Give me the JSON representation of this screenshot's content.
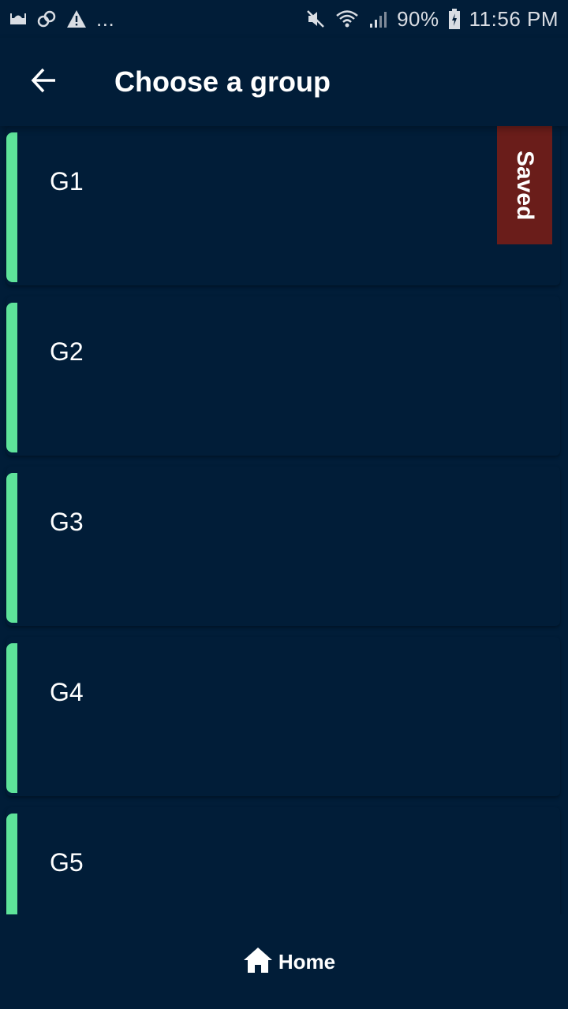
{
  "status_bar": {
    "left_icons": [
      "mosque-icon",
      "link-icon",
      "warning-icon"
    ],
    "more": "...",
    "battery": "90%",
    "time": "11:56 PM"
  },
  "app_bar": {
    "back_icon": "arrow-left-icon",
    "title": "Choose a group"
  },
  "groups": [
    {
      "label": "G1",
      "saved": true
    },
    {
      "label": "G2",
      "saved": false
    },
    {
      "label": "G3",
      "saved": false
    },
    {
      "label": "G4",
      "saved": false
    },
    {
      "label": "G5",
      "saved": false
    }
  ],
  "saved_badge": "Saved",
  "bottom_nav": {
    "home_icon": "home-icon",
    "home_label": "Home"
  },
  "colors": {
    "background": "#011d38",
    "accent": "#5ee39a",
    "saved_badge": "#6a1d1a"
  }
}
